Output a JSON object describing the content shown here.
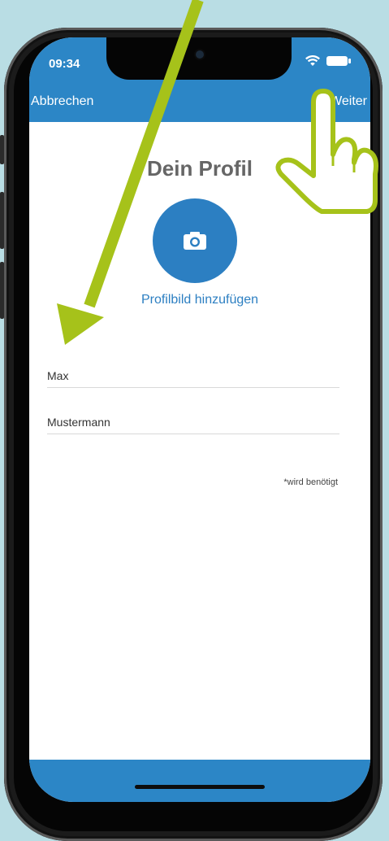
{
  "status_bar": {
    "time": "09:34"
  },
  "nav": {
    "cancel_label": "Abbrechen",
    "next_label": "Weiter"
  },
  "profile": {
    "title": "Dein Profil",
    "add_photo_label": "Profilbild hinzufügen"
  },
  "form": {
    "first_name_value": "Max",
    "last_name_value": "Mustermann",
    "required_note": "*wird benötigt"
  },
  "colors": {
    "accent": "#2c86c6",
    "annotation": "#a6c21a",
    "background": "#b9dde4"
  },
  "icons": {
    "camera": "camera-icon",
    "wifi": "wifi-icon",
    "battery": "battery-icon",
    "hand_pointer": "hand-pointer-icon",
    "arrow": "arrow-icon"
  }
}
